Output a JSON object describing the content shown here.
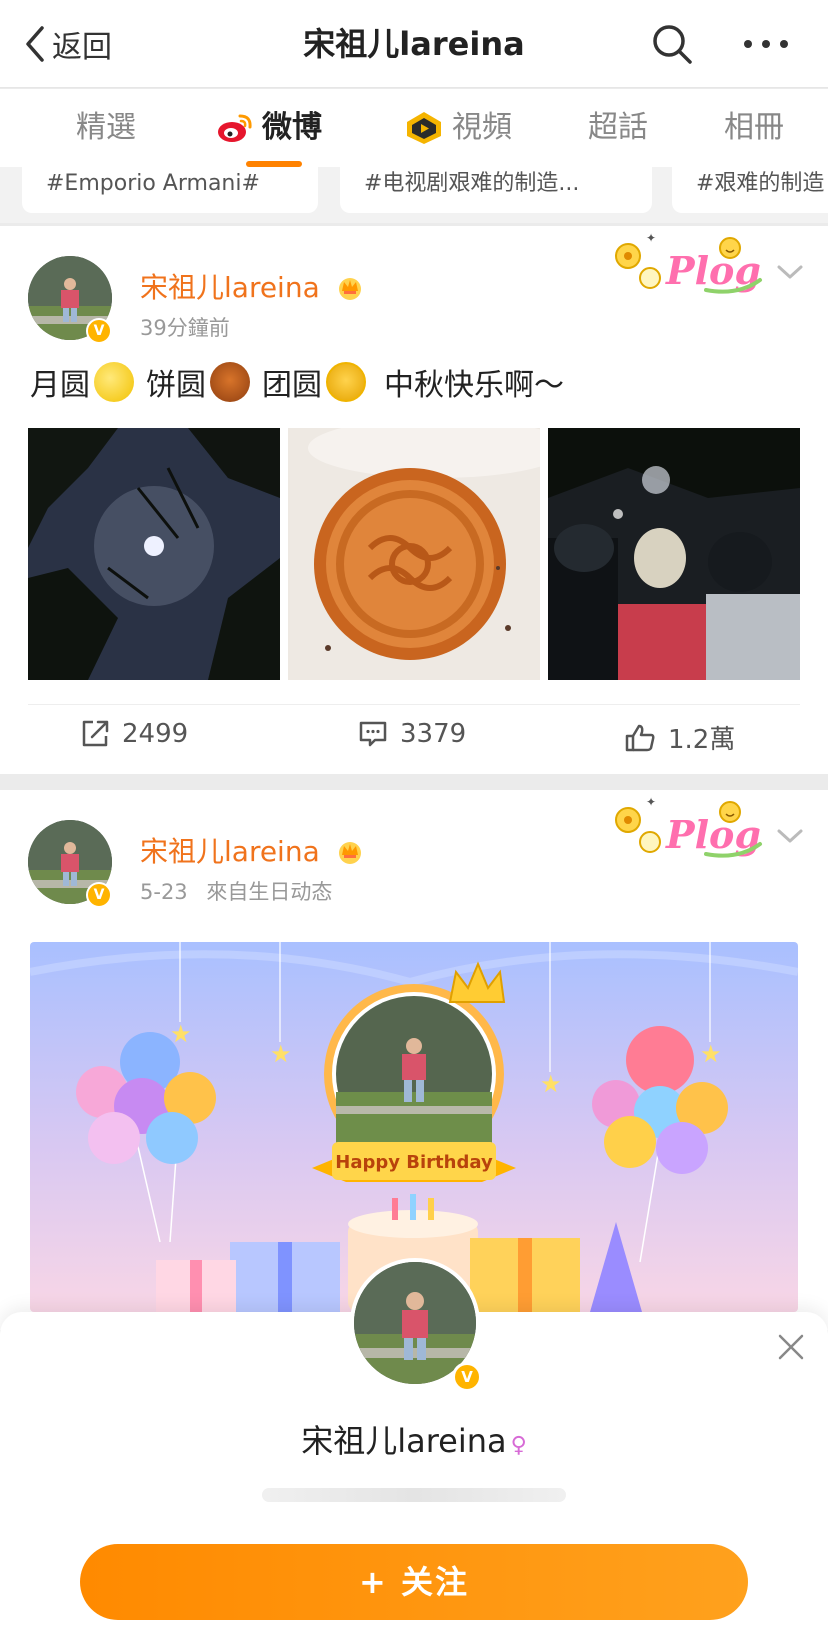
{
  "header": {
    "back_label": "返回",
    "title": "宋祖儿lareina"
  },
  "tabs": [
    {
      "label": "精選",
      "active": false
    },
    {
      "label": "微博",
      "active": true
    },
    {
      "label": "視頻",
      "active": false
    },
    {
      "label": "超話",
      "active": false
    },
    {
      "label": "相冊",
      "active": false
    }
  ],
  "topics": [
    "#Emporio Armani#",
    "#电视剧艰难的制造...",
    "#艰难的制造"
  ],
  "posts": [
    {
      "username": "宋祖儿lareina",
      "time": "39分鐘前",
      "text_parts": [
        "月圆",
        "饼圆",
        "团圆",
        "中秋快乐啊～"
      ],
      "reposts": "2499",
      "comments": "3379",
      "likes": "1.2萬"
    },
    {
      "username": "宋祖儿lareina",
      "time": "5-23",
      "source": "來自生日动态",
      "banner_text": "Happy Birthday"
    }
  ],
  "sheet": {
    "name": "宋祖儿lareina",
    "gender_symbol": "♀",
    "follow_label": "+ 关注"
  },
  "colors": {
    "accent": "#ff8200",
    "username": "#f0731c",
    "verified": "#ffb400"
  },
  "badge_text": "V",
  "plog_text": "Plog"
}
